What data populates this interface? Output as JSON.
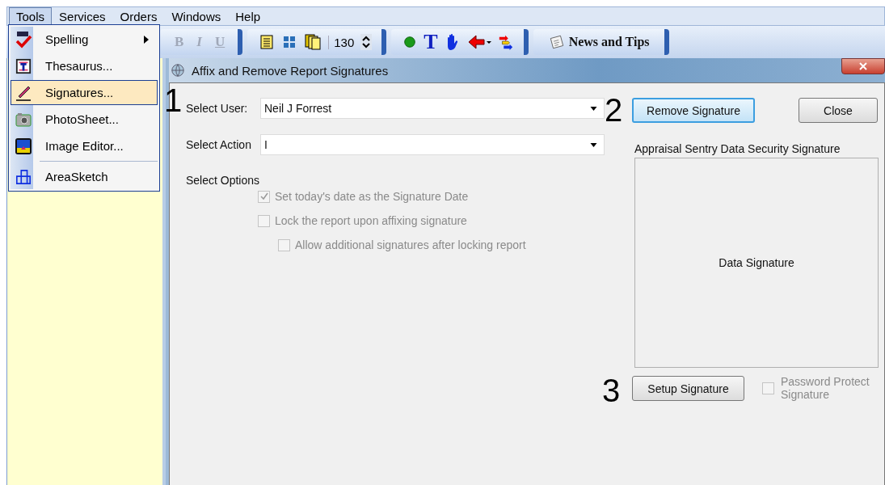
{
  "menubar": [
    {
      "label": "Tools",
      "selected": true
    },
    {
      "label": "Services",
      "selected": false
    },
    {
      "label": "Orders",
      "selected": false
    },
    {
      "label": "Windows",
      "selected": false
    },
    {
      "label": "Help",
      "selected": false
    }
  ],
  "tools_menu": [
    {
      "kind": "spelling",
      "label": "Spelling",
      "submenu": true,
      "selected": false
    },
    {
      "kind": "thesaurus",
      "label": "Thesaurus...",
      "submenu": false,
      "selected": false
    },
    {
      "kind": "signatures",
      "label": "Signatures...",
      "submenu": false,
      "selected": true
    },
    {
      "kind": "photo",
      "label": "PhotoSheet...",
      "submenu": false,
      "selected": false
    },
    {
      "kind": "image",
      "label": "Image Editor...",
      "submenu": false,
      "selected": false
    },
    {
      "kind": "separator"
    },
    {
      "kind": "sketch",
      "label": "AreaSketch",
      "submenu": false,
      "selected": false
    }
  ],
  "toolbar": {
    "format_buttons": [
      {
        "label": "B",
        "disabled": true
      },
      {
        "label": "I",
        "disabled": true
      },
      {
        "label": "U",
        "disabled": true
      }
    ],
    "zoom": "130",
    "text_tool": "T",
    "news_button": "News and Tips"
  },
  "dialog": {
    "title": "Affix and Remove Report Signatures",
    "fields": [
      {
        "label": "Select User:",
        "value": "Neil J Forrest"
      },
      {
        "label": "Select Action",
        "value": "I"
      }
    ],
    "options_label": "Select Options",
    "options": [
      {
        "label": "Set today's date as the Signature Date",
        "checked": true,
        "disabled": true
      },
      {
        "label": "Lock the report upon affixing signature",
        "checked": false,
        "disabled": true,
        "children": [
          {
            "label": "Allow additional signatures after locking report",
            "checked": false,
            "disabled": true
          }
        ]
      }
    ],
    "remove_button": {
      "label": "Remove Signature",
      "focused": true
    },
    "close_button": {
      "label": "Close",
      "focused": false
    },
    "signature_title": "Appraisal Sentry Data Security Signature",
    "signature_text": "Data Signature",
    "setup_button": {
      "label": "Setup Signature",
      "focused": false
    },
    "password_option": {
      "label": "Password Protect Signature",
      "checked": false,
      "disabled": true
    }
  },
  "annotations": [
    "1",
    "2",
    "3"
  ]
}
